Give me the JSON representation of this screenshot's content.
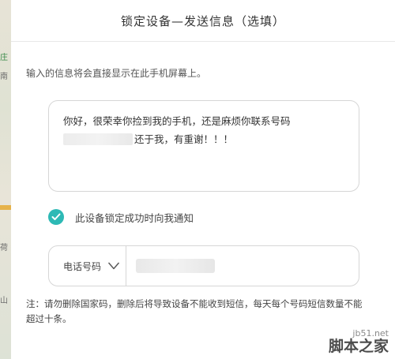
{
  "background_map": {
    "labels": [
      "庄",
      "南",
      "荷",
      "山"
    ]
  },
  "dialog": {
    "title": "锁定设备—发送信息（选填）",
    "instruction": "输入的信息将会直接显示在此手机屏幕上。",
    "message": {
      "line1": "你好，很荣幸你捡到我的手机，还是麻烦你联系号码",
      "line2": "还于我，有重谢！！！"
    },
    "notify": {
      "checked": true,
      "label": "此设备锁定成功时向我通知"
    },
    "phone": {
      "type_label": "电话号码"
    },
    "note": "注：请勿删除国家码，删除后将导致设备不能收到短信，每天每个号码短信数量不能超过十条。"
  },
  "watermark": {
    "url": "jb51.net",
    "name": "脚本之家"
  },
  "colors": {
    "accent": "#2db9b5"
  }
}
